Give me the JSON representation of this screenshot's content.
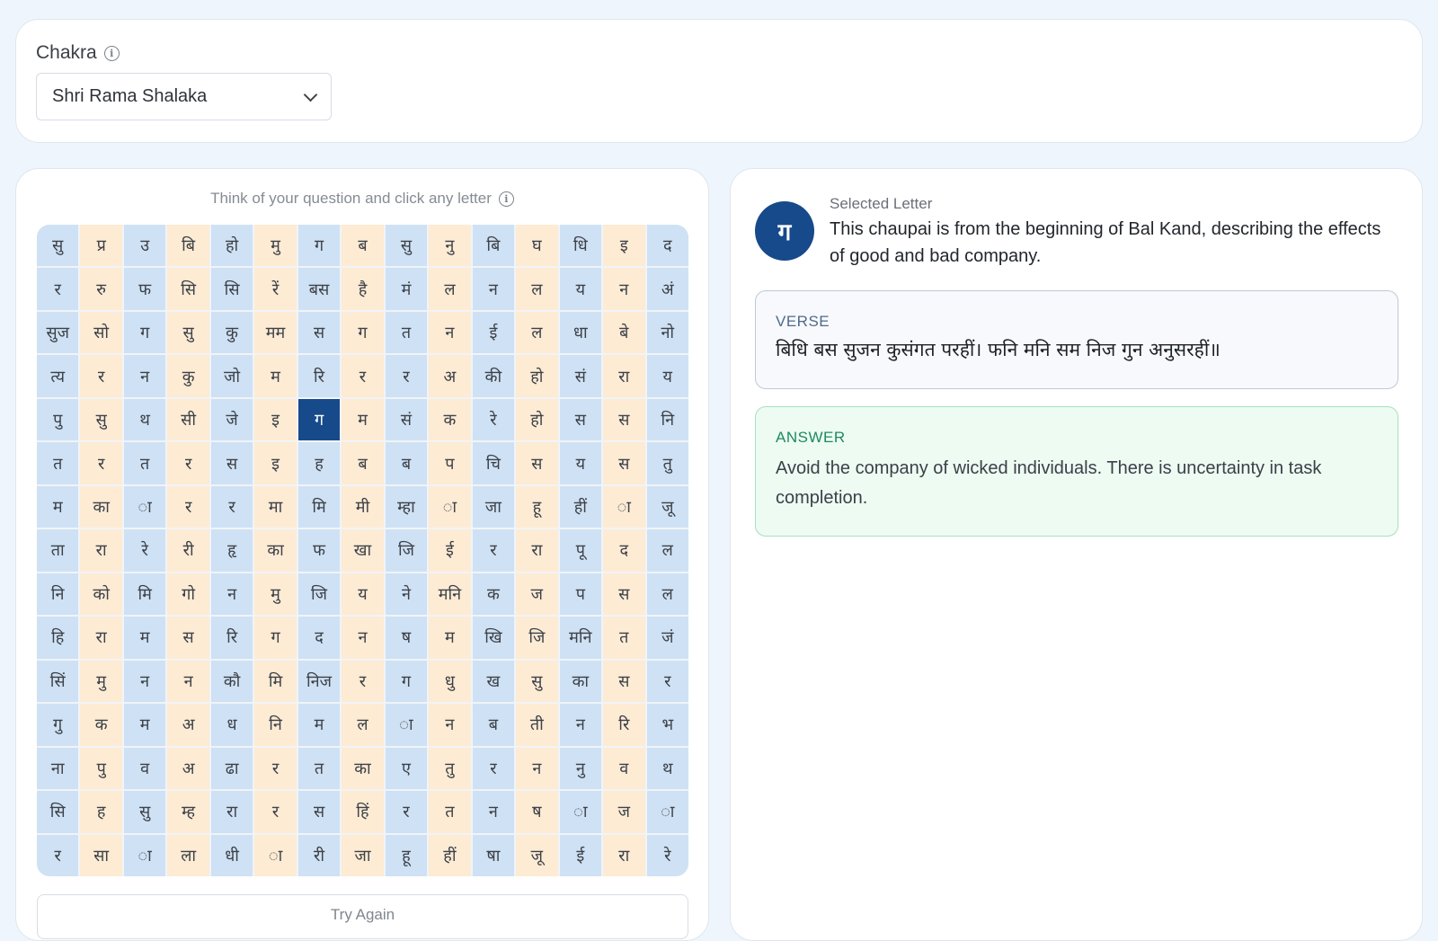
{
  "chakra": {
    "label": "Chakra",
    "selected": "Shri Rama Shalaka"
  },
  "grid": {
    "hint": "Think of your question and click any letter",
    "rows": [
      [
        "सु",
        "प्र",
        "उ",
        "बि",
        "हो",
        "मु",
        "ग",
        "ब",
        "सु",
        "नु",
        "बि",
        "घ",
        "धि",
        "इ",
        "द"
      ],
      [
        "र",
        "रु",
        "फ",
        "सि",
        "सि",
        "रें",
        "बस",
        "है",
        "मं",
        "ल",
        "न",
        "ल",
        "य",
        "न",
        "अं"
      ],
      [
        "सुज",
        "सो",
        "ग",
        "सु",
        "कु",
        "मम",
        "स",
        "ग",
        "त",
        "न",
        "ई",
        "ल",
        "धा",
        "बे",
        "नो"
      ],
      [
        "त्य",
        "र",
        "न",
        "कु",
        "जो",
        "म",
        "रि",
        "र",
        "र",
        "अ",
        "की",
        "हो",
        "सं",
        "रा",
        "य"
      ],
      [
        "पु",
        "सु",
        "थ",
        "सी",
        "जे",
        "इ",
        "ग",
        "म",
        "सं",
        "क",
        "रे",
        "हो",
        "स",
        "स",
        "नि"
      ],
      [
        "त",
        "र",
        "त",
        "र",
        "स",
        "इ",
        "ह",
        "ब",
        "ब",
        "प",
        "चि",
        "स",
        "य",
        "स",
        "तु"
      ],
      [
        "म",
        "का",
        "ा",
        "र",
        "र",
        "मा",
        "मि",
        "मी",
        "म्हा",
        "ा",
        "जा",
        "हू",
        "हीं",
        "ा",
        "जू"
      ],
      [
        "ता",
        "रा",
        "रे",
        "री",
        "हृ",
        "का",
        "फ",
        "खा",
        "जि",
        "ई",
        "र",
        "रा",
        "पू",
        "द",
        "ल"
      ],
      [
        "नि",
        "को",
        "मि",
        "गो",
        "न",
        "मु",
        "जि",
        "य",
        "ने",
        "मनि",
        "क",
        "ज",
        "प",
        "स",
        "ल"
      ],
      [
        "हि",
        "रा",
        "म",
        "स",
        "रि",
        "ग",
        "द",
        "न",
        "ष",
        "म",
        "खि",
        "जि",
        "मनि",
        "त",
        "जं"
      ],
      [
        "सिं",
        "मु",
        "न",
        "न",
        "कौ",
        "मि",
        "निज",
        "र",
        "ग",
        "धु",
        "ख",
        "सु",
        "का",
        "स",
        "र"
      ],
      [
        "गु",
        "क",
        "म",
        "अ",
        "ध",
        "नि",
        "म",
        "ल",
        "ा",
        "न",
        "ब",
        "ती",
        "न",
        "रि",
        "भ"
      ],
      [
        "ना",
        "पु",
        "व",
        "अ",
        "ढा",
        "र",
        "त",
        "का",
        "ए",
        "तु",
        "र",
        "न",
        "नु",
        "व",
        "थ"
      ],
      [
        "सि",
        "ह",
        "सु",
        "म्ह",
        "रा",
        "र",
        "स",
        "हिं",
        "र",
        "त",
        "न",
        "ष",
        "ा",
        "ज",
        "ा"
      ],
      [
        "र",
        "सा",
        "ा",
        "ला",
        "धी",
        "ा",
        "री",
        "जा",
        "हू",
        "हीं",
        "षा",
        "जू",
        "ई",
        "रा",
        "रे"
      ]
    ],
    "selected_row": 4,
    "selected_col": 6,
    "try_again_label": "Try Again"
  },
  "result": {
    "selected_letter_title": "Selected Letter",
    "selected_letter": "ग",
    "description": "This chaupai is from the beginning of Bal Kand, describing the effects of good and bad company.",
    "verse_label": "VERSE",
    "verse_text": "बिधि बस सुजन कुसंगत परहीं। फनि मनि सम निज गुन अनुसरहीं॥",
    "answer_label": "ANSWER",
    "answer_text": "Avoid the company of wicked individuals. There is uncertainty in task completion."
  },
  "colors": {
    "accent": "#164a8a",
    "cell_blue": "#cfe1f4",
    "cell_peach": "#fdebd4",
    "answer_bg": "#edfbf3",
    "answer_border": "#a7e0c1",
    "verse_bg": "#f7f9fc"
  },
  "icons": {
    "info": "info-circle-icon",
    "dropdown": "chevron-down-icon"
  }
}
